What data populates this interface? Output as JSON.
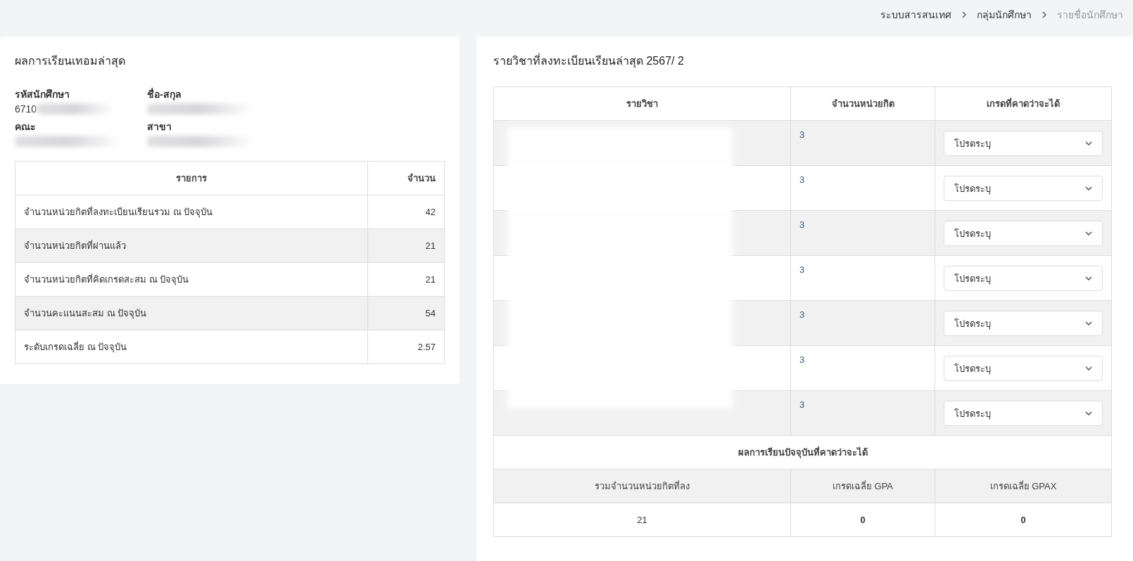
{
  "breadcrumb": [
    {
      "label": "ระบบสารสนเทศ",
      "current": false
    },
    {
      "label": "กลุ่มนักศึกษา",
      "current": false
    },
    {
      "label": "รายชื่อนักศึกษา",
      "current": true
    }
  ],
  "latest_term": {
    "title": "ผลการเรียนเทอมล่าสุด",
    "fields": [
      {
        "label": "รหัสนักศึกษา",
        "value": "6710"
      },
      {
        "label": "ชื่อ-สกุล"
      },
      {
        "label": "คณะ"
      },
      {
        "label": "สาขา"
      }
    ],
    "table": {
      "columns": [
        "รายการ",
        "จำนวน"
      ],
      "rows": [
        {
          "item": "จำนวนหน่วยกิตที่ลงทะเบียนเรียนรวม ณ ปัจจุบัน",
          "value": "42"
        },
        {
          "item": "จำนวนหน่วยกิตที่ผ่านแล้ว",
          "value": "21"
        },
        {
          "item": "จำนวนหน่วยกิตที่คิดเกรดสะสม ณ ปัจจุบัน",
          "value": "21"
        },
        {
          "item": "จำนวนคะแนนสะสม ณ ปัจจุบัน",
          "value": "54"
        },
        {
          "item": "ระดับเกรดเฉลี่ย ณ ปัจจุบัน",
          "value": "2.57"
        }
      ]
    }
  },
  "registered": {
    "title": "รายวิชาที่ลงทะเบียนเรียนล่าสุด 2567/ 2",
    "columns": [
      "รายวิชา",
      "จำนวนหน่วยกิต",
      "เกรดที่คาดว่าจะได้"
    ],
    "rows": [
      {
        "credits": "3",
        "grade_placeholder": "โปรดระบุ"
      },
      {
        "credits": "3",
        "grade_placeholder": "โปรดระบุ"
      },
      {
        "credits": "3",
        "grade_placeholder": "โปรดระบุ"
      },
      {
        "credits": "3",
        "grade_placeholder": "โปรดระบุ"
      },
      {
        "credits": "3",
        "grade_placeholder": "โปรดระบุ"
      },
      {
        "credits": "3",
        "grade_placeholder": "โปรดระบุ"
      },
      {
        "credits": "3",
        "grade_placeholder": "โปรดระบุ"
      }
    ],
    "summary_title": "ผลการเรียนปัจจุบันที่คาดว่าจะได้",
    "summary_columns": [
      "รวมจำนวนหน่วยกิตที่ลง",
      "เกรดเฉลี่ย GPA",
      "เกรดเฉลี่ย GPAX"
    ],
    "summary_values": [
      "21",
      "0",
      "0"
    ]
  }
}
